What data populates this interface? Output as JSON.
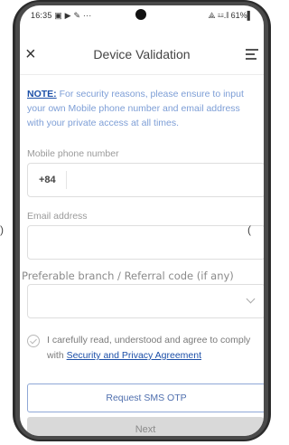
{
  "status_bar": {
    "time": "16:35",
    "notification_icons": "▣ ▶ ✎ ···",
    "right_status": "⟁ ☳.∥ 61%▌"
  },
  "header": {
    "title": "Device Validation",
    "close_glyph": "×"
  },
  "note": {
    "label": "NOTE:",
    "text": " For security reasons, please ensure to input your own Mobile phone number and email address with your private access at all times."
  },
  "form": {
    "mobile_label": "Mobile phone number",
    "mobile_prefix": "+84",
    "mobile_value": "",
    "email_label": "Email address",
    "email_value": "",
    "branch_label": "Preferable branch / Referral code (if any)",
    "branch_value": ""
  },
  "agreement": {
    "text": "I carefully read, understood and agree to comply with ",
    "link": "Security and Privacy Agreement",
    "checked": false
  },
  "buttons": {
    "otp": "Request SMS OTP",
    "next": "Next"
  },
  "colors": {
    "accent": "#1c4fa8",
    "note_text": "#7d9ed6",
    "disabled_bg": "#d9d9d9"
  }
}
